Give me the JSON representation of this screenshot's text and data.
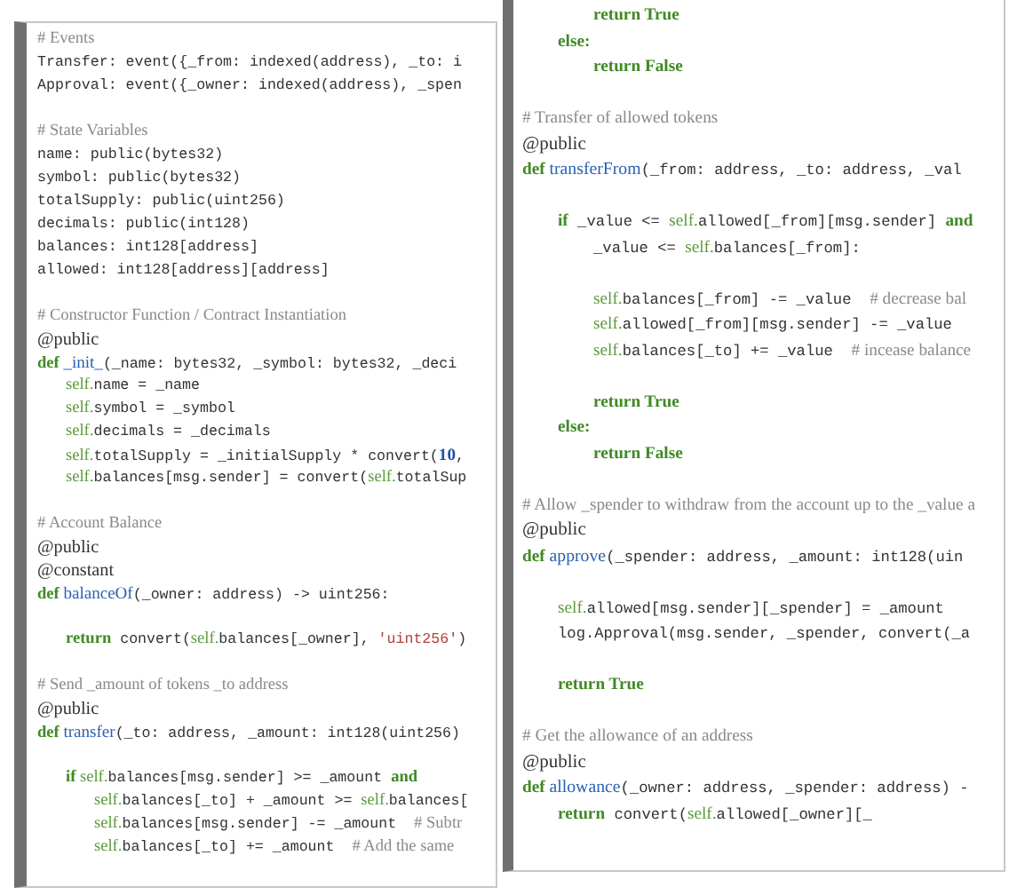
{
  "panels": [
    {
      "top_edge": true,
      "lines": [
        {
          "kind": "comment",
          "tokens": [
            {
              "kind": "comment",
              "text": "# Events"
            }
          ]
        },
        {
          "kind": "code",
          "tokens": [
            {
              "kind": "code",
              "text": "Transfer: event({_from: indexed(address), _to: i"
            }
          ]
        },
        {
          "kind": "code",
          "tokens": [
            {
              "kind": "code",
              "text": "Approval: event({_owner: indexed(address), _spen"
            }
          ]
        },
        {
          "kind": "blank"
        },
        {
          "kind": "comment",
          "tokens": [
            {
              "kind": "comment",
              "text": "# State Variables"
            }
          ]
        },
        {
          "kind": "code",
          "tokens": [
            {
              "kind": "code",
              "text": "name: public(bytes32)"
            }
          ]
        },
        {
          "kind": "code",
          "tokens": [
            {
              "kind": "code",
              "text": "symbol: public(bytes32)"
            }
          ]
        },
        {
          "kind": "code",
          "tokens": [
            {
              "kind": "code",
              "text": "totalSupply: public(uint256)"
            }
          ]
        },
        {
          "kind": "code",
          "tokens": [
            {
              "kind": "code",
              "text": "decimals: public(int128)"
            }
          ]
        },
        {
          "kind": "code",
          "tokens": [
            {
              "kind": "code",
              "text": "balances: int128[address]"
            }
          ]
        },
        {
          "kind": "code",
          "tokens": [
            {
              "kind": "code",
              "text": "allowed: int128[address][address]"
            }
          ]
        },
        {
          "kind": "blank"
        },
        {
          "kind": "comment",
          "tokens": [
            {
              "kind": "comment",
              "text": "# Constructor Function / Contract Instantiation"
            }
          ]
        },
        {
          "kind": "decorator",
          "tokens": [
            {
              "kind": "decorator",
              "text": "@public"
            }
          ]
        },
        {
          "kind": "code",
          "tokens": [
            {
              "kind": "keyword",
              "text": "def "
            },
            {
              "kind": "function",
              "text": "_init_"
            },
            {
              "kind": "code",
              "text": "(_name: bytes32, _symbol: bytes32, _deci"
            }
          ],
          "children": [
            {
              "kind": "code",
              "tokens": [
                {
                  "kind": "self",
                  "text": "self."
                },
                {
                  "kind": "code",
                  "text": "name = _name"
                }
              ]
            },
            {
              "kind": "code",
              "tokens": [
                {
                  "kind": "self",
                  "text": "self."
                },
                {
                  "kind": "code",
                  "text": "symbol = _symbol"
                }
              ]
            },
            {
              "kind": "code",
              "tokens": [
                {
                  "kind": "self",
                  "text": "self."
                },
                {
                  "kind": "code",
                  "text": "decimals = _decimals"
                }
              ]
            },
            {
              "kind": "code",
              "tokens": [
                {
                  "kind": "self",
                  "text": "self."
                },
                {
                  "kind": "code",
                  "text": "totalSupply = _initialSupply * convert("
                },
                {
                  "kind": "number",
                  "text": "10"
                },
                {
                  "kind": "code",
                  "text": ","
                }
              ]
            },
            {
              "kind": "code",
              "tokens": [
                {
                  "kind": "self",
                  "text": "self."
                },
                {
                  "kind": "code",
                  "text": "balances[msg.sender] = convert("
                },
                {
                  "kind": "self",
                  "text": "self."
                },
                {
                  "kind": "code",
                  "text": "totalSup"
                }
              ]
            }
          ]
        },
        {
          "kind": "blank"
        },
        {
          "kind": "comment",
          "tokens": [
            {
              "kind": "comment",
              "text": "# Account Balance"
            }
          ]
        },
        {
          "kind": "decorator",
          "tokens": [
            {
              "kind": "decorator",
              "text": "@public"
            }
          ]
        },
        {
          "kind": "decorator",
          "tokens": [
            {
              "kind": "decorator",
              "text": "@constant"
            }
          ]
        },
        {
          "kind": "code",
          "tokens": [
            {
              "kind": "keyword",
              "text": "def "
            },
            {
              "kind": "function",
              "text": "balanceOf"
            },
            {
              "kind": "code",
              "text": "(_owner: address) -> uint256:"
            }
          ],
          "children": [
            {
              "kind": "blank"
            },
            {
              "kind": "code",
              "tokens": [
                {
                  "kind": "keyword",
                  "text": "return"
                },
                {
                  "kind": "code",
                  "text": " convert("
                },
                {
                  "kind": "self",
                  "text": "self."
                },
                {
                  "kind": "code",
                  "text": "balances[_owner], "
                },
                {
                  "kind": "string",
                  "text": "'uint256'"
                },
                {
                  "kind": "code",
                  "text": ")"
                }
              ]
            }
          ]
        },
        {
          "kind": "blank"
        },
        {
          "kind": "comment",
          "tokens": [
            {
              "kind": "comment",
              "text": "# Send _amount of tokens _to address"
            }
          ]
        },
        {
          "kind": "decorator",
          "tokens": [
            {
              "kind": "decorator",
              "text": "@public"
            }
          ]
        },
        {
          "kind": "code",
          "tokens": [
            {
              "kind": "keyword",
              "text": "def "
            },
            {
              "kind": "function",
              "text": "transfer"
            },
            {
              "kind": "code",
              "text": "(_to: address, _amount: int128(uint256)"
            }
          ],
          "children": [
            {
              "kind": "blank"
            },
            {
              "kind": "code",
              "tokens": [
                {
                  "kind": "keyword",
                  "text": "if "
                },
                {
                  "kind": "self",
                  "text": "self."
                },
                {
                  "kind": "code",
                  "text": "balances[msg.sender] >= _amount "
                },
                {
                  "kind": "keyword",
                  "text": "and"
                }
              ],
              "children": [
                {
                  "kind": "code",
                  "tokens": [
                    {
                      "kind": "self",
                      "text": "self."
                    },
                    {
                      "kind": "code",
                      "text": "balances[_to] + _amount >= "
                    },
                    {
                      "kind": "self",
                      "text": "self."
                    },
                    {
                      "kind": "code",
                      "text": "balances["
                    }
                  ]
                },
                {
                  "kind": "code",
                  "tokens": [
                    {
                      "kind": "self",
                      "text": "self."
                    },
                    {
                      "kind": "code",
                      "text": "balances[msg.sender] -= _amount  "
                    },
                    {
                      "kind": "comment",
                      "text": "# Subtr"
                    }
                  ]
                },
                {
                  "kind": "code",
                  "tokens": [
                    {
                      "kind": "self",
                      "text": "self."
                    },
                    {
                      "kind": "code",
                      "text": "balances[_to] += _amount  "
                    },
                    {
                      "kind": "comment",
                      "text": "# Add the same"
                    }
                  ]
                }
              ]
            }
          ]
        }
      ]
    },
    {
      "top_edge": false,
      "lines": [
        {
          "kind": "group",
          "children": [
            {
              "kind": "group",
              "children": [
                {
                  "kind": "code",
                  "tokens": [
                    {
                      "kind": "keyword",
                      "text": "return True"
                    }
                  ]
                }
              ]
            },
            {
              "kind": "code",
              "tokens": [
                {
                  "kind": "keyword",
                  "text": "else:"
                }
              ],
              "children": [
                {
                  "kind": "code",
                  "tokens": [
                    {
                      "kind": "keyword",
                      "text": "return False"
                    }
                  ]
                }
              ]
            }
          ]
        },
        {
          "kind": "blank"
        },
        {
          "kind": "comment",
          "tokens": [
            {
              "kind": "comment",
              "text": "# Transfer of allowed tokens"
            }
          ]
        },
        {
          "kind": "decorator",
          "tokens": [
            {
              "kind": "decorator",
              "text": "@public"
            }
          ]
        },
        {
          "kind": "code",
          "tokens": [
            {
              "kind": "keyword",
              "text": "def "
            },
            {
              "kind": "function",
              "text": "transferFrom"
            },
            {
              "kind": "code",
              "text": "(_from: address, _to: address, _val"
            }
          ],
          "children": [
            {
              "kind": "blank"
            },
            {
              "kind": "code",
              "tokens": [
                {
                  "kind": "keyword",
                  "text": "if"
                },
                {
                  "kind": "code",
                  "text": " _value <= "
                },
                {
                  "kind": "self",
                  "text": "self."
                },
                {
                  "kind": "code",
                  "text": "allowed[_from][msg.sender] "
                },
                {
                  "kind": "keyword",
                  "text": "and"
                }
              ],
              "children": [
                {
                  "kind": "code",
                  "tokens": [
                    {
                      "kind": "code",
                      "text": "_value <= "
                    },
                    {
                      "kind": "self",
                      "text": "self."
                    },
                    {
                      "kind": "code",
                      "text": "balances[_from]:"
                    }
                  ]
                },
                {
                  "kind": "blank"
                },
                {
                  "kind": "code",
                  "tokens": [
                    {
                      "kind": "self",
                      "text": "self."
                    },
                    {
                      "kind": "code",
                      "text": "balances[_from] -= _value  "
                    },
                    {
                      "kind": "comment",
                      "text": "# decrease bal"
                    }
                  ]
                },
                {
                  "kind": "code",
                  "tokens": [
                    {
                      "kind": "self",
                      "text": "self."
                    },
                    {
                      "kind": "code",
                      "text": "allowed[_from][msg.sender] -= _value"
                    }
                  ]
                },
                {
                  "kind": "code",
                  "tokens": [
                    {
                      "kind": "self",
                      "text": "self."
                    },
                    {
                      "kind": "code",
                      "text": "balances[_to] += _value  "
                    },
                    {
                      "kind": "comment",
                      "text": "# incease balance"
                    }
                  ]
                },
                {
                  "kind": "blank"
                },
                {
                  "kind": "code",
                  "tokens": [
                    {
                      "kind": "keyword",
                      "text": "return True"
                    }
                  ]
                }
              ]
            },
            {
              "kind": "code",
              "tokens": [
                {
                  "kind": "keyword",
                  "text": "else:"
                }
              ],
              "children": [
                {
                  "kind": "code",
                  "tokens": [
                    {
                      "kind": "keyword",
                      "text": "return False"
                    }
                  ]
                }
              ]
            }
          ]
        },
        {
          "kind": "blank"
        },
        {
          "kind": "comment",
          "tokens": [
            {
              "kind": "comment",
              "text": "# Allow _spender to withdraw from the account up to the _value a"
            }
          ]
        },
        {
          "kind": "decorator",
          "tokens": [
            {
              "kind": "decorator",
              "text": "@public"
            }
          ]
        },
        {
          "kind": "code",
          "tokens": [
            {
              "kind": "keyword",
              "text": "def "
            },
            {
              "kind": "function",
              "text": "approve"
            },
            {
              "kind": "code",
              "text": "(_spender: address, _amount: int128(uin"
            }
          ],
          "children": [
            {
              "kind": "blank"
            },
            {
              "kind": "code",
              "tokens": [
                {
                  "kind": "self",
                  "text": "self."
                },
                {
                  "kind": "code",
                  "text": "allowed[msg.sender][_spender] = _amount"
                }
              ]
            },
            {
              "kind": "code",
              "tokens": [
                {
                  "kind": "code",
                  "text": "log.Approval(msg.sender, _spender, convert(_a"
                }
              ]
            },
            {
              "kind": "blank"
            },
            {
              "kind": "code",
              "tokens": [
                {
                  "kind": "keyword",
                  "text": "return True"
                }
              ]
            }
          ]
        },
        {
          "kind": "blank"
        },
        {
          "kind": "comment",
          "tokens": [
            {
              "kind": "comment",
              "text": "# Get the allowance of an address"
            }
          ]
        },
        {
          "kind": "decorator",
          "tokens": [
            {
              "kind": "decorator",
              "text": "@public"
            }
          ]
        },
        {
          "kind": "code",
          "tokens": [
            {
              "kind": "keyword",
              "text": "def "
            },
            {
              "kind": "function",
              "text": "allowance"
            },
            {
              "kind": "code",
              "text": "(_owner: address, _spender: address) -"
            }
          ],
          "children": [
            {
              "kind": "code",
              "tokens": [
                {
                  "kind": "keyword",
                  "text": "return"
                },
                {
                  "kind": "code",
                  "text": " convert("
                },
                {
                  "kind": "self",
                  "text": "self."
                },
                {
                  "kind": "code",
                  "text": "allowed[_owner][_"
                }
              ]
            }
          ]
        }
      ]
    }
  ]
}
